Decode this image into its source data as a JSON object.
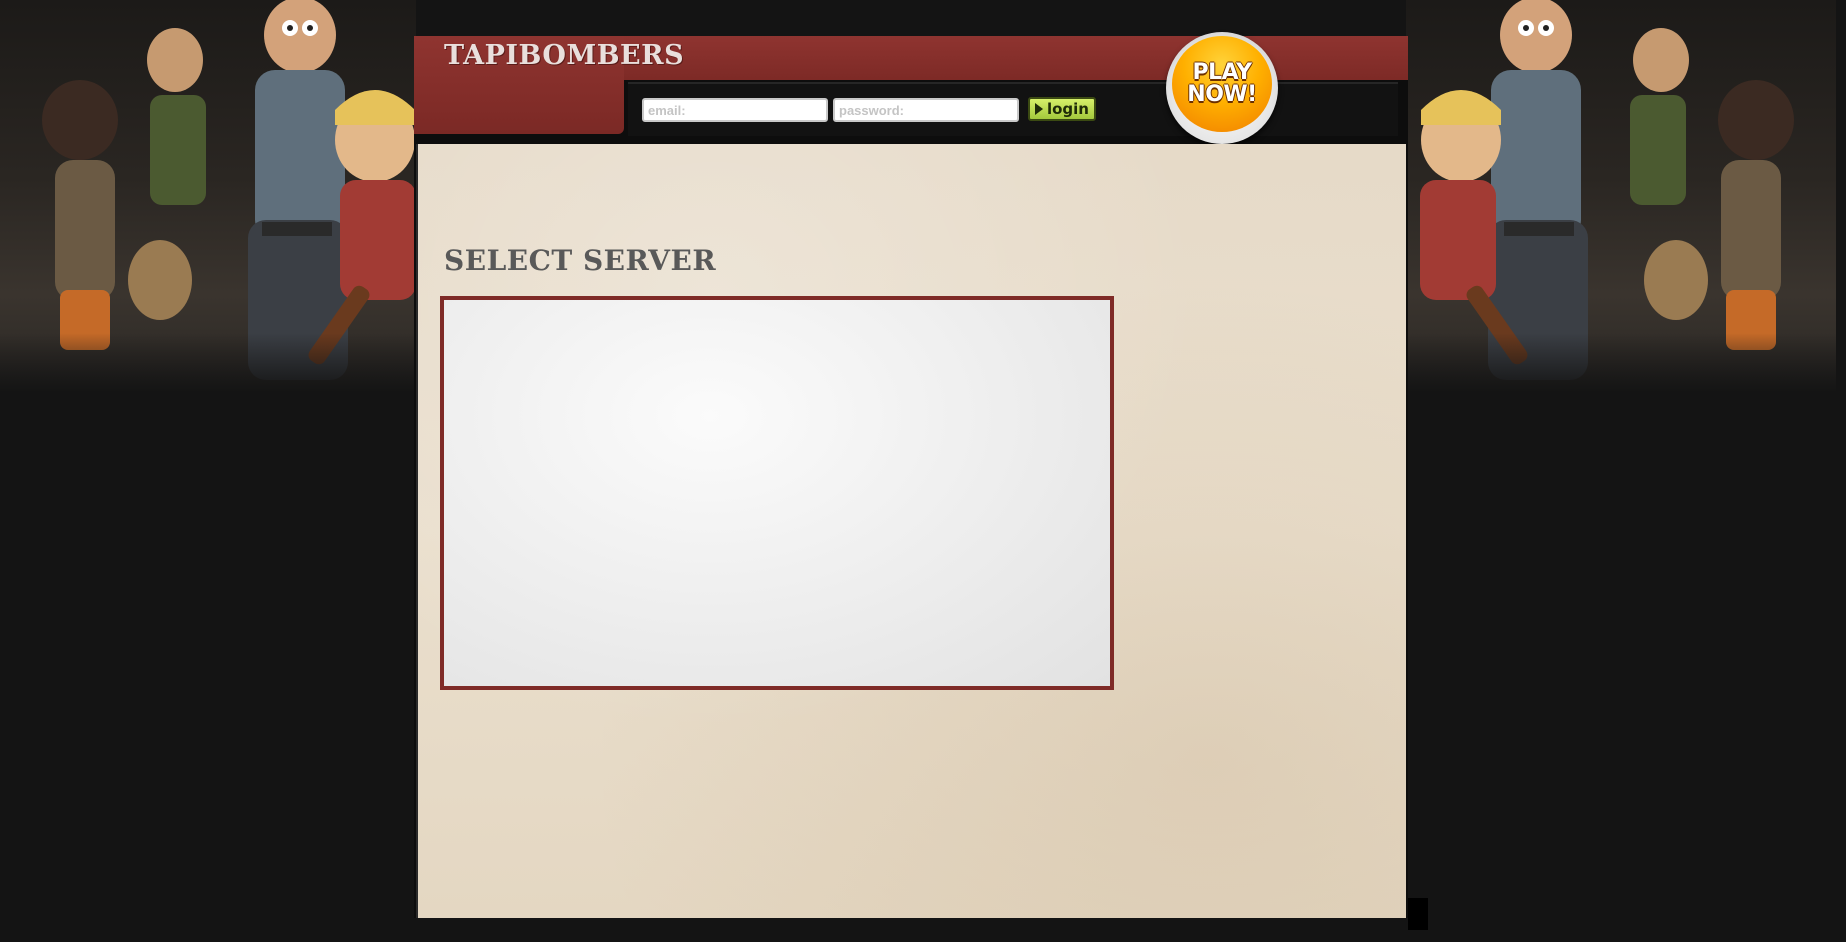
{
  "header": {
    "brand": "TAPIBOMBERS"
  },
  "login": {
    "email_placeholder": "email:",
    "password_placeholder": "password:",
    "login_label": "login"
  },
  "play_now": {
    "line1": "PLAY",
    "line2": "NOW!"
  },
  "main": {
    "title": "SELECT SERVER",
    "servers": []
  },
  "colors": {
    "accent_red": "#8a302c",
    "login_green": "#b6d64e",
    "play_orange": "#ffb000",
    "paper": "#e8dcc9",
    "background": "#141414"
  },
  "icons": {
    "login": "play-triangle-icon"
  }
}
